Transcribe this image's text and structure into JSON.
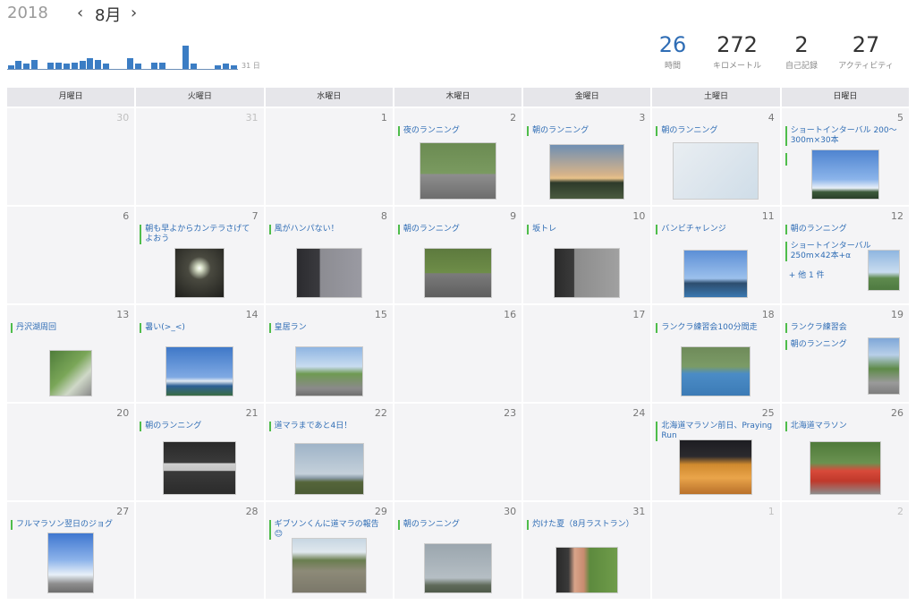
{
  "header": {
    "year": "2018",
    "month": "8月",
    "prev_icon": "‹",
    "next_icon": "›",
    "sparkline_end_label": "31 日",
    "sparkline_values": [
      3,
      6,
      4,
      7,
      0,
      5,
      5,
      4,
      5,
      6,
      8,
      7,
      4,
      0,
      0,
      8,
      4,
      0,
      5,
      5,
      0,
      0,
      18,
      4,
      0,
      0,
      3,
      4,
      3
    ]
  },
  "stats": [
    {
      "value": "26",
      "label": "時間"
    },
    {
      "value": "272",
      "label": "キロメートル"
    },
    {
      "value": "2",
      "label": "自己記録"
    },
    {
      "value": "27",
      "label": "アクティビティ"
    }
  ],
  "weekdays": [
    "月曜日",
    "火曜日",
    "水曜日",
    "木曜日",
    "金曜日",
    "土曜日",
    "日曜日"
  ],
  "weeks": [
    {
      "days": [
        {
          "num": "30",
          "dim": true,
          "activities": [],
          "photo": null
        },
        {
          "num": "31",
          "dim": true,
          "activities": [],
          "photo": null
        },
        {
          "num": "1",
          "activities": [],
          "photo": null
        },
        {
          "num": "2",
          "activities": [
            "夜のランニング"
          ],
          "photo": "cat-on-wall"
        },
        {
          "num": "3",
          "activities": [
            "朝のランニング"
          ],
          "photo": "sunrise-riverside"
        },
        {
          "num": "4",
          "activities": [
            "朝のランニング"
          ],
          "photo": "route-map"
        },
        {
          "num": "5",
          "activities": [
            "ショートインターバル 200〜300m×30本",
            ""
          ],
          "photo": "blue-sky-field"
        }
      ]
    },
    {
      "days": [
        {
          "num": "6",
          "activities": [],
          "photo": null
        },
        {
          "num": "7",
          "activities": [
            "朝も早よからカンテラさげてよおう"
          ],
          "photo": "lamp-night"
        },
        {
          "num": "8",
          "activities": [
            "風がハンパない！"
          ],
          "photo": "building-dusk"
        },
        {
          "num": "9",
          "activities": [
            "朝のランニング"
          ],
          "photo": "cat-garden"
        },
        {
          "num": "10",
          "activities": [
            "坂トレ"
          ],
          "photo": "shirt-railing"
        },
        {
          "num": "11",
          "activities": [
            "バンビチャレンジ"
          ],
          "photo": "track-sky"
        },
        {
          "num": "12",
          "activities": [
            "朝のランニング",
            "ショートインターバル 250m×42本+α"
          ],
          "more": "+ 他 1 件",
          "photo": "track-small"
        }
      ]
    },
    {
      "days": [
        {
          "num": "13",
          "activities": [
            "丹沢湖周回"
          ],
          "photo": "lake-selfie"
        },
        {
          "num": "14",
          "activities": [
            "暑い(>_<)"
          ],
          "photo": "stadium-blue"
        },
        {
          "num": "15",
          "activities": [
            "皇居ラン"
          ],
          "photo": "park-runner"
        },
        {
          "num": "16",
          "activities": [],
          "photo": null
        },
        {
          "num": "17",
          "activities": [],
          "photo": null
        },
        {
          "num": "18",
          "activities": [
            "ランクラ練習会100分間走"
          ],
          "photo": "group-photo"
        },
        {
          "num": "19",
          "activities": [
            "ランクラ練習会",
            "朝のランニング"
          ],
          "photo": "path-trees"
        }
      ]
    },
    {
      "days": [
        {
          "num": "20",
          "activities": [],
          "photo": null
        },
        {
          "num": "21",
          "activities": [
            "朝のランニング"
          ],
          "photo": "shoes-signs"
        },
        {
          "num": "22",
          "activities": [
            "道マラまであと4日！"
          ],
          "photo": "river-haze"
        },
        {
          "num": "23",
          "activities": [],
          "photo": null
        },
        {
          "num": "24",
          "activities": [],
          "photo": null
        },
        {
          "num": "25",
          "activities": [
            "北海道マラソン前日、Praying Run"
          ],
          "photo": "drink-table"
        },
        {
          "num": "26",
          "activities": [
            "北海道マラソン"
          ],
          "photo": "marathon-group"
        }
      ]
    },
    {
      "days": [
        {
          "num": "27",
          "activities": [
            "フルマラソン翌日のジョグ"
          ],
          "photo": "runner-sky"
        },
        {
          "num": "28",
          "activities": [],
          "photo": null
        },
        {
          "num": "29",
          "activities": [
            "ギブソンくんに道マラの報告😊"
          ],
          "photo": "cat-park"
        },
        {
          "num": "30",
          "activities": [
            "朝のランニング"
          ],
          "photo": "grey-sky"
        },
        {
          "num": "31",
          "activities": [
            "灼けた夏（8月ラストラン）"
          ],
          "photo": "arm-grass"
        },
        {
          "num": "1",
          "dim": true,
          "activities": [],
          "photo": null
        },
        {
          "num": "2",
          "dim": true,
          "activities": [],
          "photo": null
        }
      ]
    }
  ]
}
